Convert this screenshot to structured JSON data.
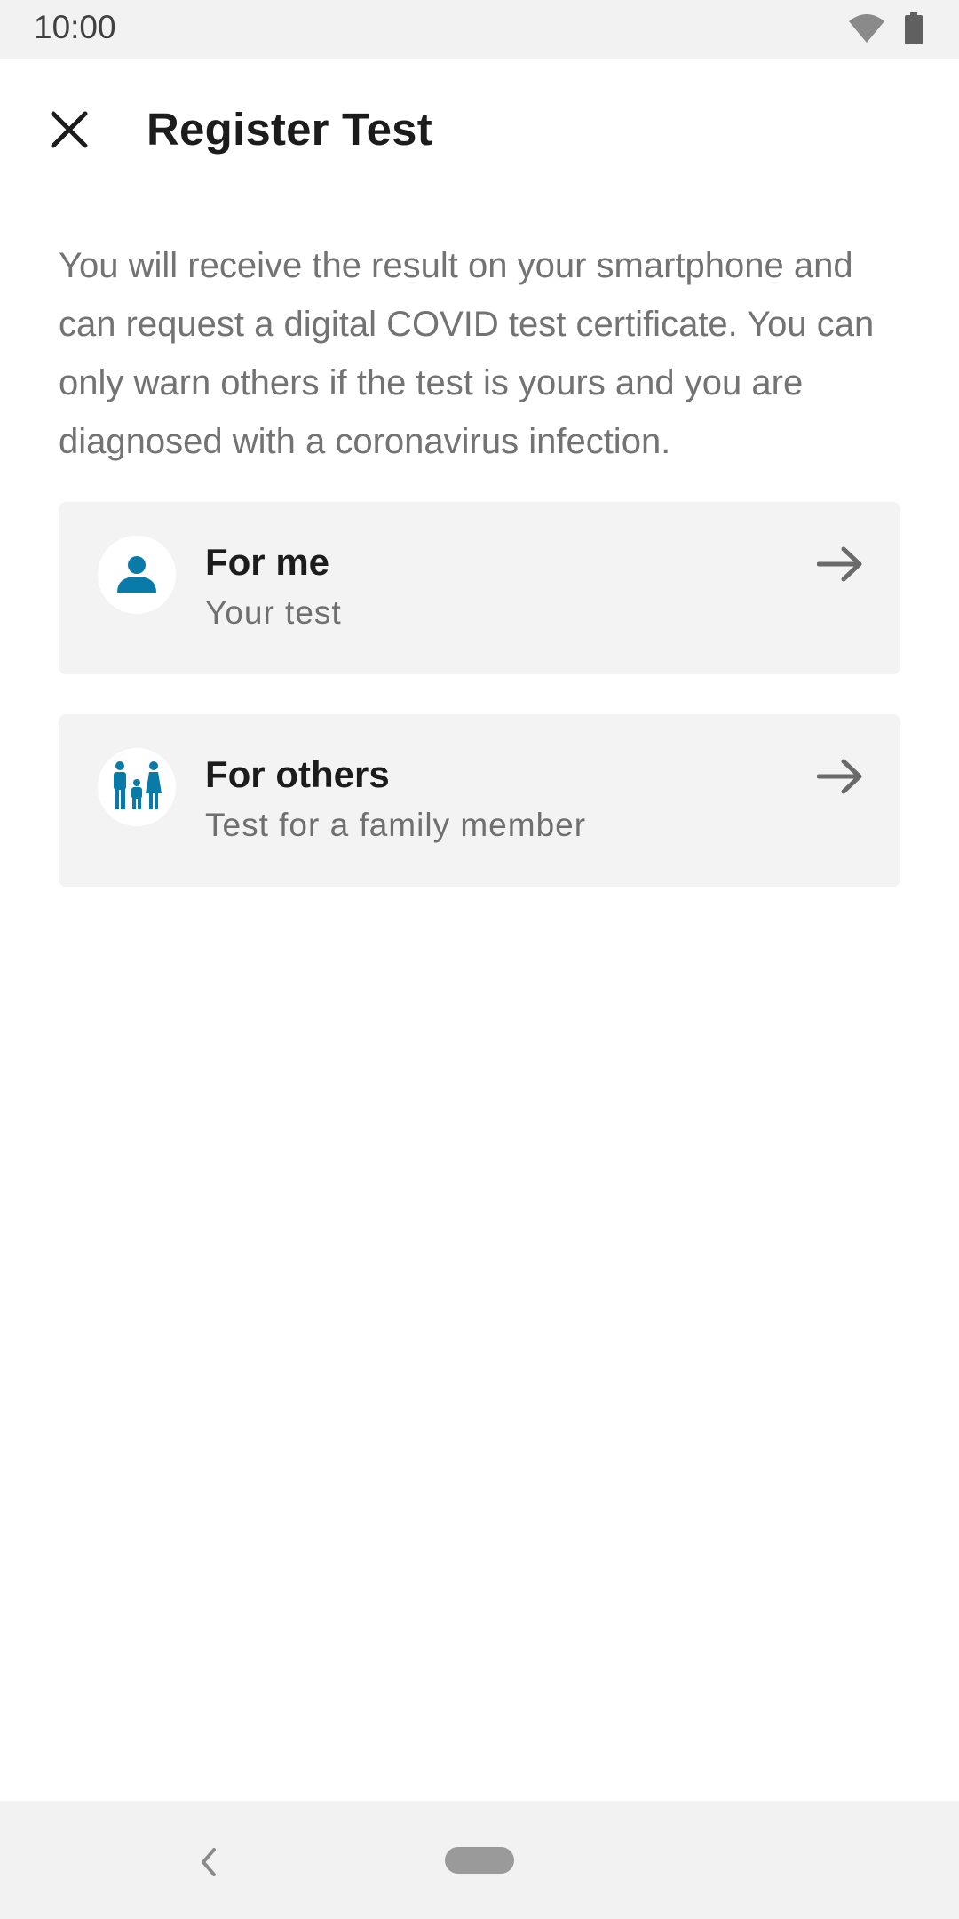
{
  "status_bar": {
    "time": "10:00",
    "icons": [
      "wifi-icon",
      "battery-icon"
    ]
  },
  "header": {
    "title": "Register Test",
    "close_icon": "close-icon"
  },
  "intro": {
    "text": "You will receive the result on your smartphone and can request a digital COVID test certificate. You can only warn others if the test is yours and you are diagnosed with a coronavirus infection."
  },
  "options": [
    {
      "title": "For me",
      "subtitle": "Your test",
      "icon": "person-icon",
      "arrow": "arrow-right-icon"
    },
    {
      "title": "For others",
      "subtitle": "Test for a family member",
      "icon": "family-icon",
      "arrow": "arrow-right-icon"
    }
  ],
  "nav_bar": {
    "back_icon": "back-icon",
    "home_icon": "home-pill-icon"
  },
  "colors": {
    "accent": "#0a7aa8",
    "card_background": "#f3f3f3",
    "body_text": "#737373",
    "title_text": "#1c1c1c"
  }
}
